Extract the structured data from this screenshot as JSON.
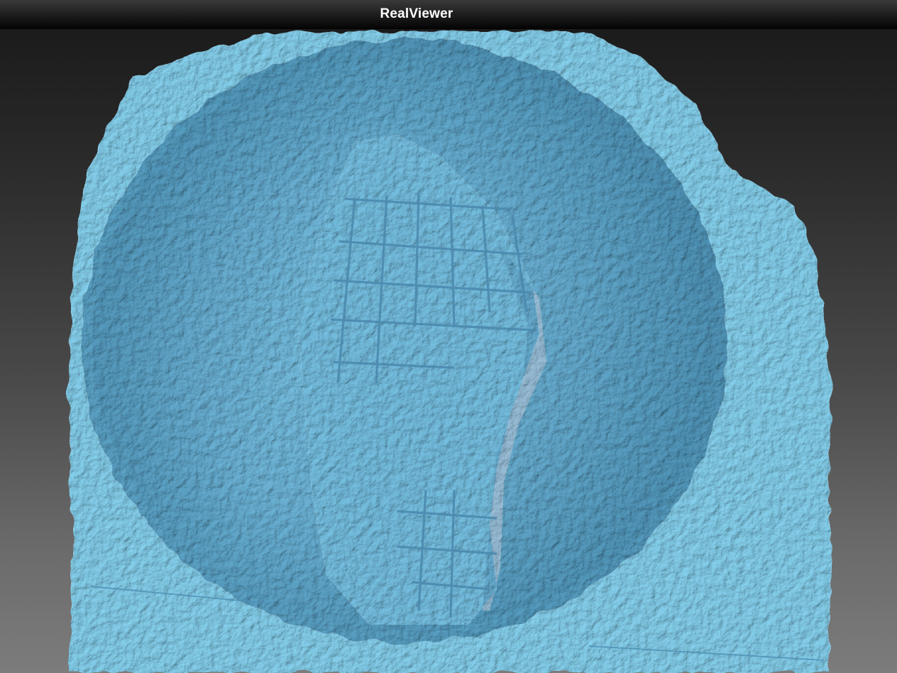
{
  "window": {
    "title": "RealViewer"
  },
  "viewport": {
    "background_top": "#1b1b1b",
    "background_bottom": "#7c7c7c"
  },
  "model": {
    "surface_color": "#7ccbe8",
    "shadow_color": "#4f93b6",
    "highlight_color": "#a9e2f5"
  }
}
